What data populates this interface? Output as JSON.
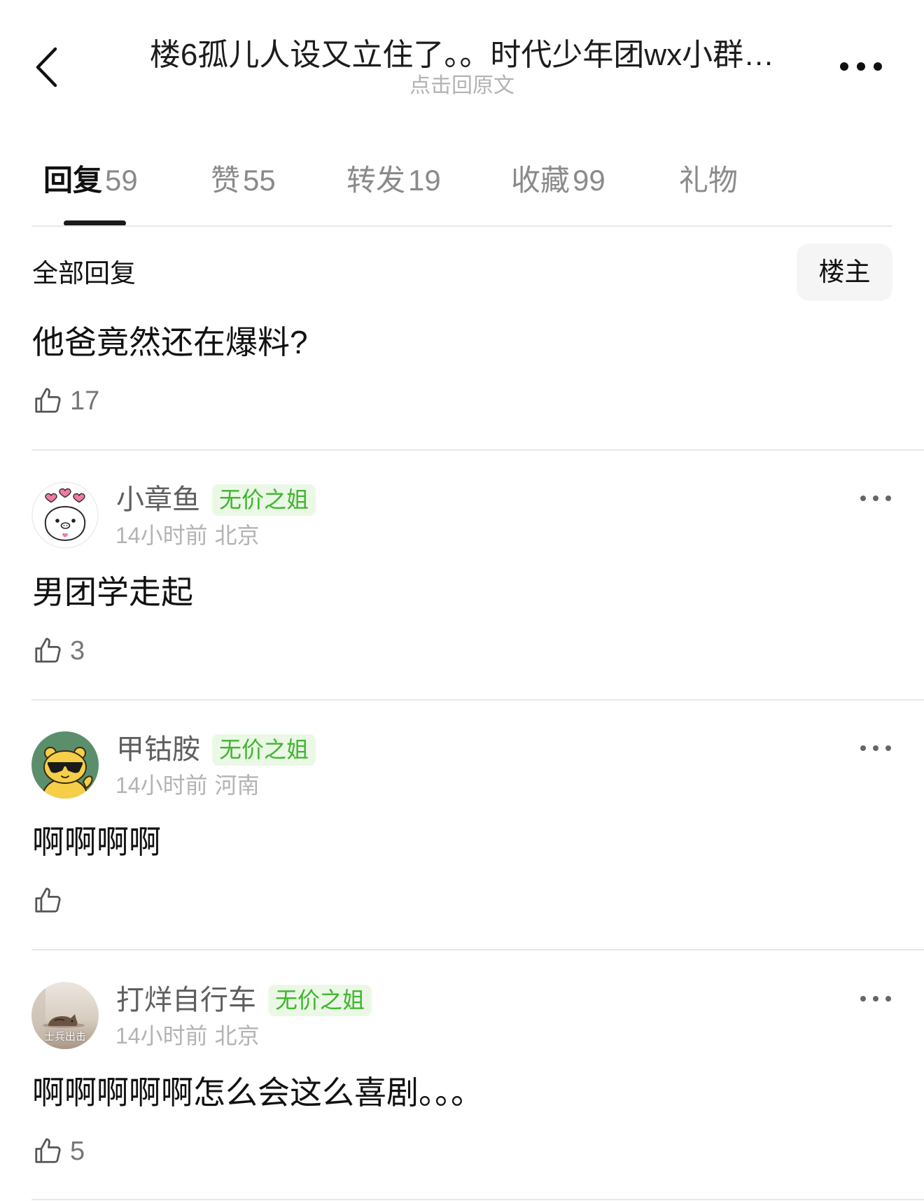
{
  "header": {
    "back_icon": "chevron-left-icon",
    "title": "楼6孤儿人设又立住了。。时代少年团wx小群…",
    "subtitle": "点击回原文",
    "more_icon": "more-horizontal-icon"
  },
  "tabs": [
    {
      "label": "回复",
      "count": "59",
      "active": true
    },
    {
      "label": "赞",
      "count": "55"
    },
    {
      "label": "转发",
      "count": "19"
    },
    {
      "label": "收藏",
      "count": "99"
    },
    {
      "label": "礼物"
    }
  ],
  "section": {
    "title": "全部回复",
    "filter_button": "楼主"
  },
  "post_reply": {
    "text": "他爸竟然还在爆料?",
    "likes": "17",
    "like_icon": "thumbs-up-icon"
  },
  "comments": [
    {
      "name": "小章鱼",
      "badge": "无价之姐",
      "time": "14小时前",
      "location": "北京",
      "text": "男团学走起",
      "likes": "3",
      "like_icon": "thumbs-up-icon",
      "more_icon": "more-horizontal-icon"
    },
    {
      "name": "甲钴胺",
      "badge": "无价之姐",
      "time": "14小时前",
      "location": "河南",
      "text": "啊啊啊啊",
      "like_icon": "thumbs-up-icon",
      "more_icon": "more-horizontal-icon"
    },
    {
      "name": "打烊自行车",
      "badge": "无价之姐",
      "time": "14小时前",
      "location": "北京",
      "text": "啊啊啊啊啊怎么会这么喜剧。。。",
      "likes": "5",
      "avatar_caption": "士兵出击",
      "like_icon": "thumbs-up-icon",
      "more_icon": "more-horizontal-icon"
    }
  ],
  "colors": {
    "text_primary": "#111111",
    "text_secondary": "#5f5f5f",
    "text_muted": "#b3b3b3",
    "tab_inactive": "#8a8a8a",
    "like_count": "#777777",
    "badge_text": "#3fb52f",
    "badge_bg": "#ebf8e6",
    "divider": "#e8e8e8",
    "indicator": "#1a1a1a",
    "button_bg": "#f5f5f5"
  }
}
